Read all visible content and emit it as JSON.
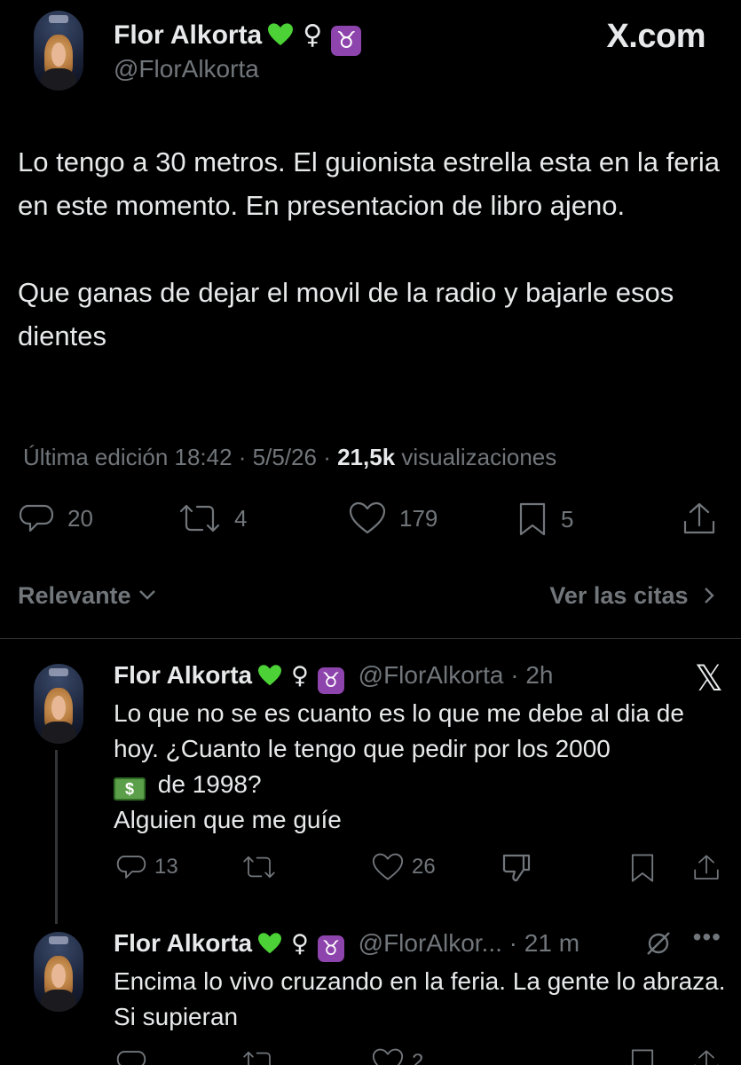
{
  "site_logo": "X.com",
  "main_tweet": {
    "display_name": "Flor Alkorta",
    "handle": "@FlorAlkorta",
    "emojis": [
      "green-heart",
      "♀",
      "♉"
    ],
    "text": "Lo tengo a 30 metros. El guionista estrella esta en la feria en este momento. En presentacion de libro ajeno.\n\nQue ganas de dejar el movil de la radio y bajarle esos dientes",
    "edited_label": "Última edición 18:42 · 5/5/26",
    "views_count": "21,5k",
    "views_label": "visualizaciones",
    "replies": "20",
    "reposts": "4",
    "likes": "179",
    "bookmarks": "5"
  },
  "sort": {
    "label": "Relevante",
    "quotes_label": "Ver las citas"
  },
  "replies": [
    {
      "display_name": "Flor Alkorta",
      "handle": "@FlorAlkorta",
      "time": "2h",
      "text_line1": "Lo que no se es cuanto es lo que me debe al dia de hoy. ¿Cuanto le tengo que pedir por los 2000",
      "dollar_emoji": "$",
      "text_line2": "de 1998?",
      "text_line3": "Alguien que me guíe",
      "replies": "13",
      "reposts": "",
      "likes": "26"
    },
    {
      "display_name": "Flor Alkorta",
      "handle": "@FlorAlkor...",
      "time": "21 m",
      "text": "Encima lo vivo cruzando en la feria. La gente lo abraza. Si supieran",
      "likes": "2"
    }
  ],
  "colors": {
    "background": "#000000",
    "text": "#e7e9ea",
    "muted": "#71767b",
    "divider": "#2f3336",
    "taurus_bg": "#8e44ad",
    "heart": "#4cd137"
  }
}
